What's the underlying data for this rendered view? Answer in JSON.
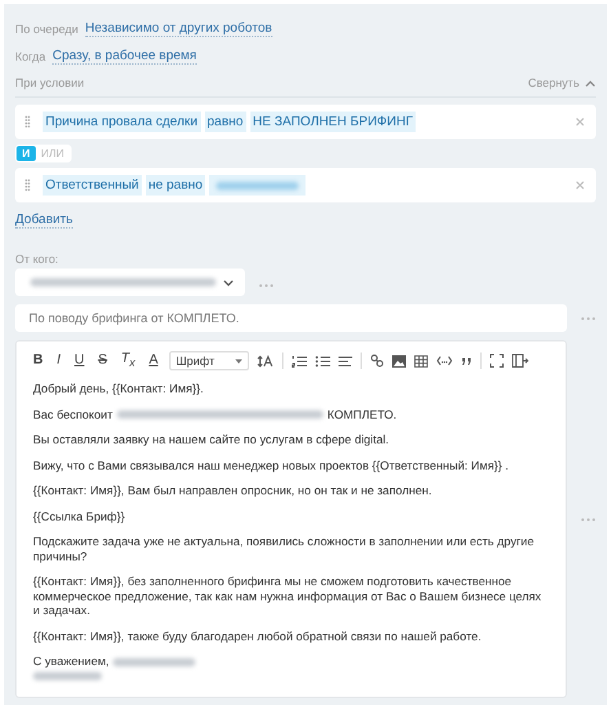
{
  "queue": {
    "label": "По очереди",
    "value": "Независимо от других роботов"
  },
  "when": {
    "label": "Когда",
    "value": "Сразу, в рабочее время"
  },
  "conditions": {
    "title": "При условии",
    "collapse": "Свернуть",
    "rules": [
      {
        "field": "Причина провала сделки",
        "operator": "равно",
        "value": {
          "kind": "text",
          "text": "НЕ ЗАПОЛНЕН БРИФИНГ"
        }
      },
      {
        "field": "Ответственный",
        "operator": "не равно",
        "value": {
          "kind": "redacted"
        }
      }
    ],
    "logic": [
      {
        "label": "И",
        "selected": true
      },
      {
        "label": "ИЛИ",
        "selected": false
      }
    ],
    "add": "Добавить"
  },
  "from": {
    "label": "От кого:",
    "value": {
      "kind": "redacted"
    }
  },
  "subject": {
    "value": "По поводу брифинга от КОМПЛЕТО."
  },
  "toolbar": [
    {
      "kind": "bold",
      "label": "B"
    },
    {
      "kind": "italic",
      "label": "I"
    },
    {
      "kind": "underline",
      "label": "U"
    },
    {
      "kind": "strike",
      "label": "S"
    },
    {
      "kind": "clear",
      "label": "T$_{x}$"
    },
    {
      "kind": "color",
      "label": "A"
    },
    {
      "kind": "select",
      "label": "Шрифт"
    },
    {
      "kind": "size"
    },
    {
      "kind": "sep"
    },
    {
      "kind": "ol"
    },
    {
      "kind": "ul"
    },
    {
      "kind": "align"
    },
    {
      "kind": "sep"
    },
    {
      "kind": "link"
    },
    {
      "kind": "image"
    },
    {
      "kind": "table"
    },
    {
      "kind": "code"
    },
    {
      "kind": "quote"
    },
    {
      "kind": "sep"
    },
    {
      "kind": "fullscreen"
    },
    {
      "kind": "source"
    }
  ],
  "paragraphs": [
    {
      "parts": [
        {
          "kind": "text",
          "text": "Добрый день, {{Контакт: Имя}}."
        }
      ]
    },
    {
      "parts": [
        {
          "kind": "text",
          "text": "Вас беспокоит"
        },
        {
          "kind": "redacted"
        },
        {
          "kind": "text",
          "text": "КОМПЛЕТО."
        }
      ]
    },
    {
      "parts": [
        {
          "kind": "text",
          "text": "Вы оставляли заявку на нашем сайте по услугам в сфере digital."
        }
      ]
    },
    {
      "parts": [
        {
          "kind": "text",
          "text": "Вижу, что с Вами связывался наш менеджер новых проектов {{Ответственный: Имя}} ."
        }
      ]
    },
    {
      "parts": [
        {
          "kind": "text",
          "text": "{{Контакт: Имя}}, Вам был направлен опросник, но он так и не заполнен."
        }
      ]
    },
    {
      "parts": [
        {
          "kind": "text",
          "text": " {{Ссылка Бриф}}"
        }
      ]
    },
    {
      "parts": [
        {
          "kind": "text",
          "text": "Подскажите задача уже не актуальна, появились сложности в заполнении или есть другие причины?"
        }
      ]
    },
    {
      "parts": [
        {
          "kind": "text",
          "text": "{{Контакт: Имя}}, без заполненного брифинга мы не сможем подготовить качественное коммерческое предложение, так как нам нужна информация от Вас о Вашем бизнесе целях и задачах."
        }
      ]
    },
    {
      "parts": [
        {
          "kind": "text",
          "text": "{{Контакт: Имя}}, также буду благодарен любой обратной связи по нашей работе."
        }
      ]
    },
    {
      "parts": [
        {
          "kind": "text",
          "text": "С уважением,"
        },
        {
          "kind": "redacted"
        },
        {
          "kind": "break"
        },
        {
          "kind": "redacted"
        }
      ]
    }
  ]
}
